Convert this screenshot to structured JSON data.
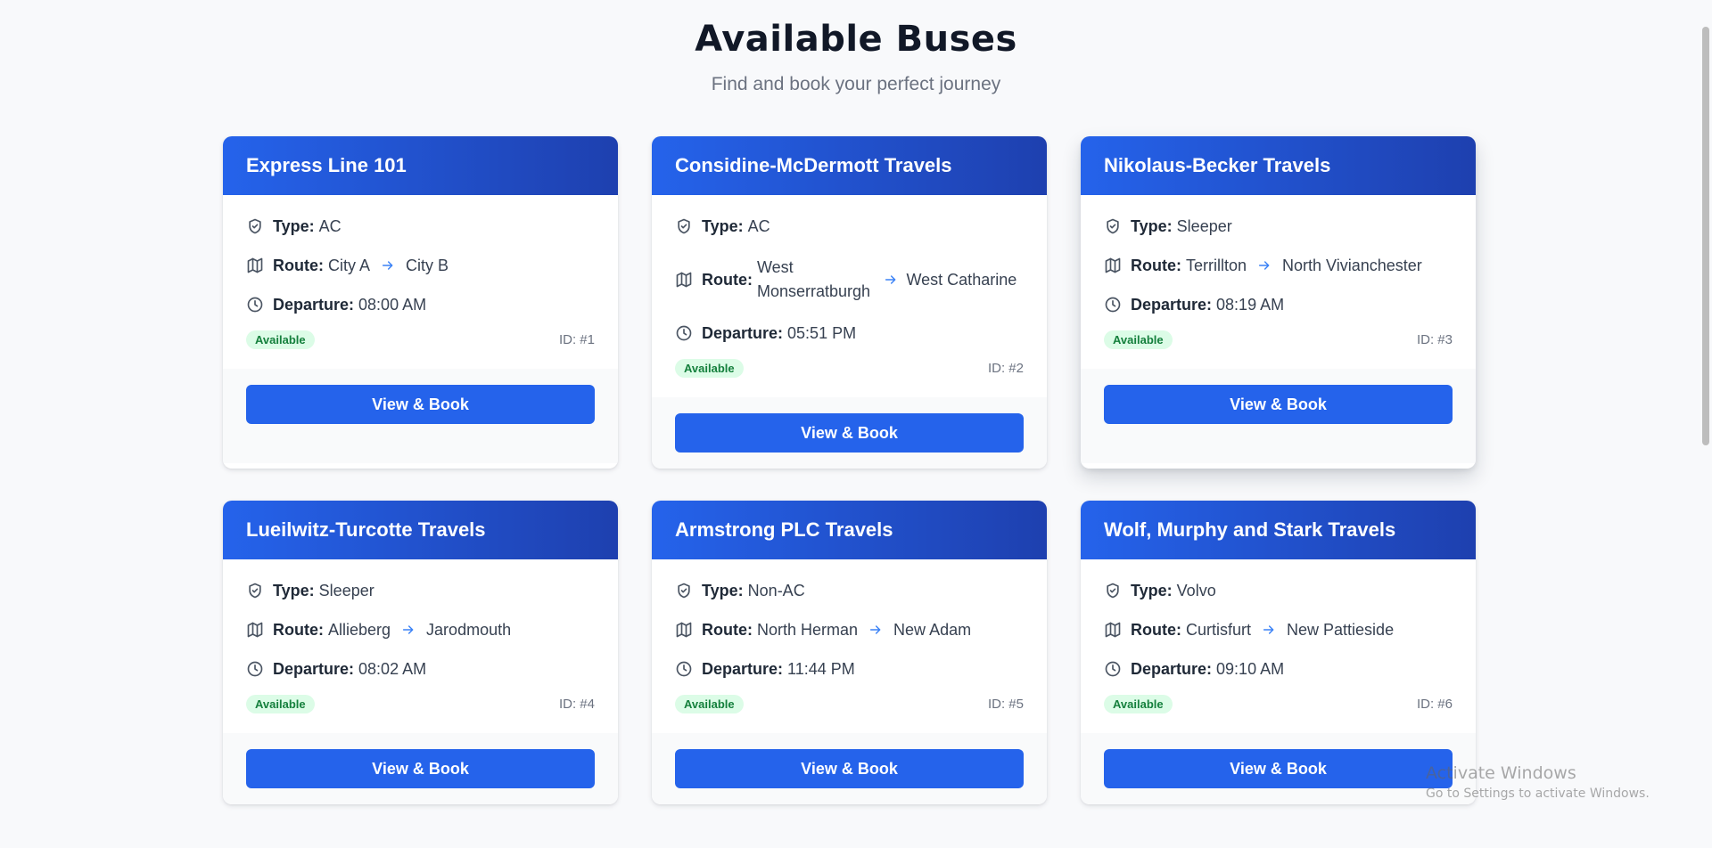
{
  "header": {
    "title": "Available Buses",
    "subtitle": "Find and book your perfect journey"
  },
  "labels": {
    "type": "Type:",
    "route": "Route:",
    "departure": "Departure:"
  },
  "buses": [
    {
      "name": "Express Line 101",
      "type": "AC",
      "from": "City A",
      "to": "City B",
      "departure": "08:00 AM",
      "status": "Available",
      "id": "ID: #1",
      "button": "View & Book"
    },
    {
      "name": "Considine-McDermott Travels",
      "type": "AC",
      "from": "West Monserratburgh",
      "to": "West Catharine",
      "departure": "05:51 PM",
      "status": "Available",
      "id": "ID: #2",
      "button": "View & Book"
    },
    {
      "name": "Nikolaus-Becker Travels",
      "type": "Sleeper",
      "from": "Terrillton",
      "to": "North Vivianchester",
      "departure": "08:19 AM",
      "status": "Available",
      "id": "ID: #3",
      "button": "View & Book"
    },
    {
      "name": "Lueilwitz-Turcotte Travels",
      "type": "Sleeper",
      "from": "Allieberg",
      "to": "Jarodmouth",
      "departure": "08:02 AM",
      "status": "Available",
      "id": "ID: #4",
      "button": "View & Book"
    },
    {
      "name": "Armstrong PLC Travels",
      "type": "Non-AC",
      "from": "North Herman",
      "to": "New Adam",
      "departure": "11:44 PM",
      "status": "Available",
      "id": "ID: #5",
      "button": "View & Book"
    },
    {
      "name": "Wolf, Murphy and Stark Travels",
      "type": "Volvo",
      "from": "Curtisfurt",
      "to": "New Pattieside",
      "departure": "09:10 AM",
      "status": "Available",
      "id": "ID: #6",
      "button": "View & Book"
    }
  ],
  "icons": {
    "type": "shield-check-icon",
    "route": "map-icon",
    "arrow": "arrow-right-icon",
    "departure": "clock-icon"
  },
  "colors": {
    "header_gradient_start": "#2563eb",
    "header_gradient_end": "#1e40af",
    "button": "#2563eb",
    "badge_bg": "#dcfce7",
    "badge_text": "#15803d"
  },
  "watermark": {
    "title": "Activate Windows",
    "subtitle": "Go to Settings to activate Windows."
  }
}
